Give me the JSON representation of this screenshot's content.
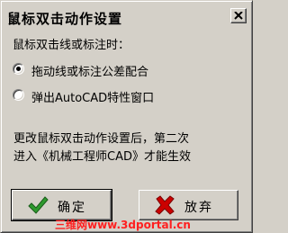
{
  "window": {
    "title": "鼠标双击动作设置",
    "close_label": "×"
  },
  "prompt": "鼠标双击线或标注时：",
  "options": [
    {
      "label": "拖动线或标注公差配合",
      "selected": true
    },
    {
      "label": "弹出AutoCAD特性窗口",
      "selected": false
    }
  ],
  "notice": [
    "更改鼠标双击动作设置后，第二次",
    "进入《机械工程师CAD》才能生效"
  ],
  "buttons": {
    "ok_label": "确定",
    "ok_icon": "checkmark-icon",
    "cancel_label": "放弃",
    "cancel_icon": "red-x-icon"
  },
  "watermark": "三维网www.3dportal.cn",
  "colors": {
    "dialog_bg": "#d4d0c8",
    "check_green": "#2e9a2e",
    "x_red": "#cc0000",
    "watermark_red": "#ff2020"
  }
}
